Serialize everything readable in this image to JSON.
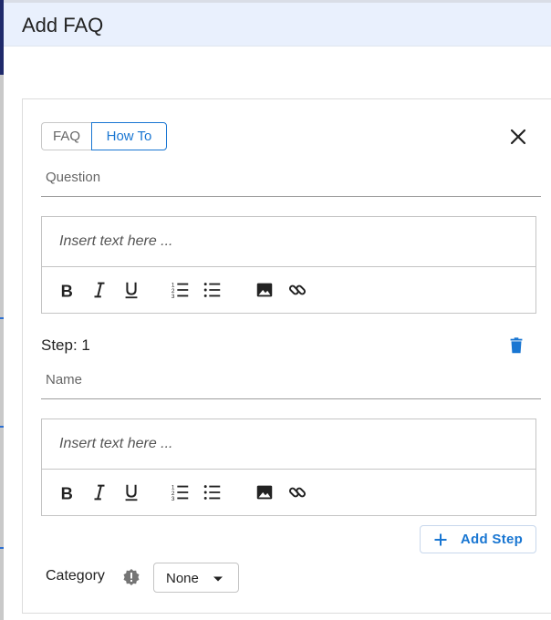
{
  "header": {
    "title": "Add FAQ"
  },
  "mode_toggle": {
    "faq_label": "FAQ",
    "howto_label": "How To",
    "selected": "How To"
  },
  "question": {
    "placeholder": "Question"
  },
  "editor1": {
    "placeholder": "Insert text here ..."
  },
  "step": {
    "label": "Step: 1",
    "name_placeholder": "Name"
  },
  "editor2": {
    "placeholder": "Insert text here ..."
  },
  "toolbar_icons": [
    "bold-icon",
    "italic-icon",
    "underline-icon",
    "ordered-list-icon",
    "bullet-list-icon",
    "image-icon",
    "link-icon"
  ],
  "add_step": {
    "label": "Add Step"
  },
  "category": {
    "label": "Category",
    "value": "None"
  },
  "colors": {
    "accent": "#1976d2",
    "header_bg": "#e9f0fd",
    "border": "#c4c4c4"
  }
}
